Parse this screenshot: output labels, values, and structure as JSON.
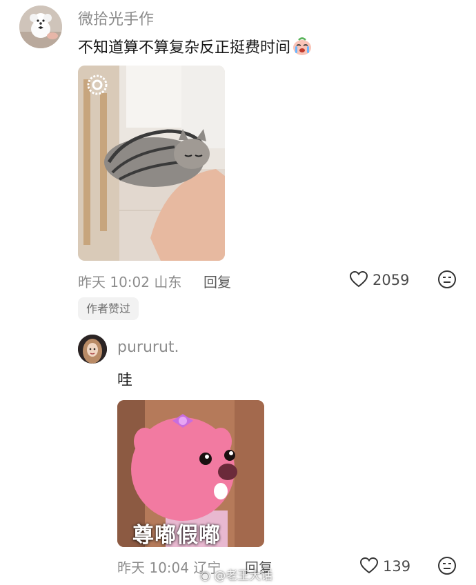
{
  "comment": {
    "username": "微拾光手作",
    "text": "不知道算不算复杂反正挺费时间",
    "emoji": "crying-face-emoji",
    "photo_alt": "hand-holding-cat-photo",
    "time": "昨天 10:02",
    "location": "山东",
    "reply_label": "回复",
    "likes": "2059",
    "author_badge": "作者赞过"
  },
  "reply": {
    "username": "pururut.",
    "text": "哇",
    "sticker_caption": "尊嘟假嘟",
    "time": "昨天 10:04",
    "location": "辽宁",
    "reply_label": "回复",
    "likes": "139"
  },
  "watermark": "@老王大话",
  "colors": {
    "meta_gray": "#8c8c8c",
    "text_dark": "#161616",
    "badge_bg": "#f2f2f2",
    "sticker_pink": "#f07aa0"
  }
}
